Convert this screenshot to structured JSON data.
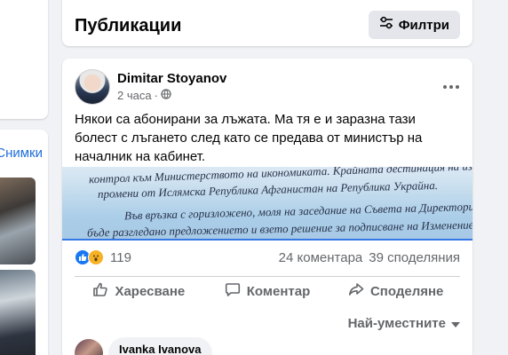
{
  "sidebar": {
    "photos_link": "Снимки"
  },
  "publications": {
    "title": "Публикации",
    "filter_label": "Филтри"
  },
  "post": {
    "author": "Dimitar Stoyanov",
    "time": "2 часа",
    "time_separator": "·",
    "text": "Някои са абонирани за лъжата. Ма тя е и заразна тази болест с лъгането след като се предава от министър на началник на кабинет.",
    "image_text": {
      "line1": "контрол към Министерството на икономиката. Крайната дестинация на изделията",
      "line2": "промени от Ислямска Република Афганистан на Република Украйна.",
      "line3": "Във връзка с горизложено, моля на заседание на Съвета на Директорите",
      "line4": "бъде разгледано предложението и взето решение за подписване на Изменение N"
    },
    "reactions_count": "119",
    "comments_count": "24 коментара",
    "shares_count": "39 споделяния",
    "actions": {
      "like": "Харесване",
      "comment": "Коментар",
      "share": "Споделяне"
    },
    "sort_label": "Най-уместните",
    "first_comment_author": "Ivanka Ivanova"
  },
  "icons": {
    "filter": "sliders-icon",
    "globe": "globe-icon",
    "more": "more-horizontal-icon",
    "like_reaction": "like-reaction-icon",
    "wow_reaction": "wow-reaction-icon",
    "like_action": "thumbs-up-icon",
    "comment_action": "speech-bubble-icon",
    "share_action": "share-arrow-icon",
    "sort": "caret-down-icon"
  },
  "colors": {
    "accent": "#1877f2",
    "link": "#216fdb",
    "secondary_text": "#65676b",
    "background": "#f0f2f5",
    "wow": "#f7b125"
  }
}
